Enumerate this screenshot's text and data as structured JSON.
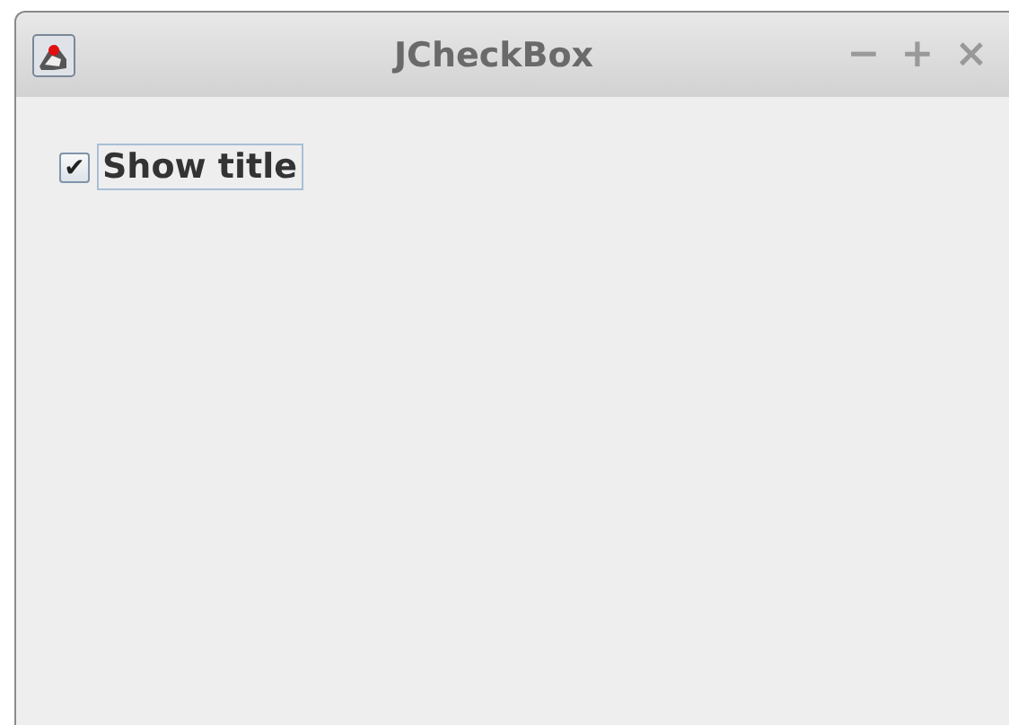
{
  "window": {
    "title": "JCheckBox",
    "controls": [
      "−",
      "+",
      "×"
    ]
  },
  "checkbox": {
    "label": "Show title",
    "checked": true,
    "focused": true,
    "mark": "✔"
  }
}
